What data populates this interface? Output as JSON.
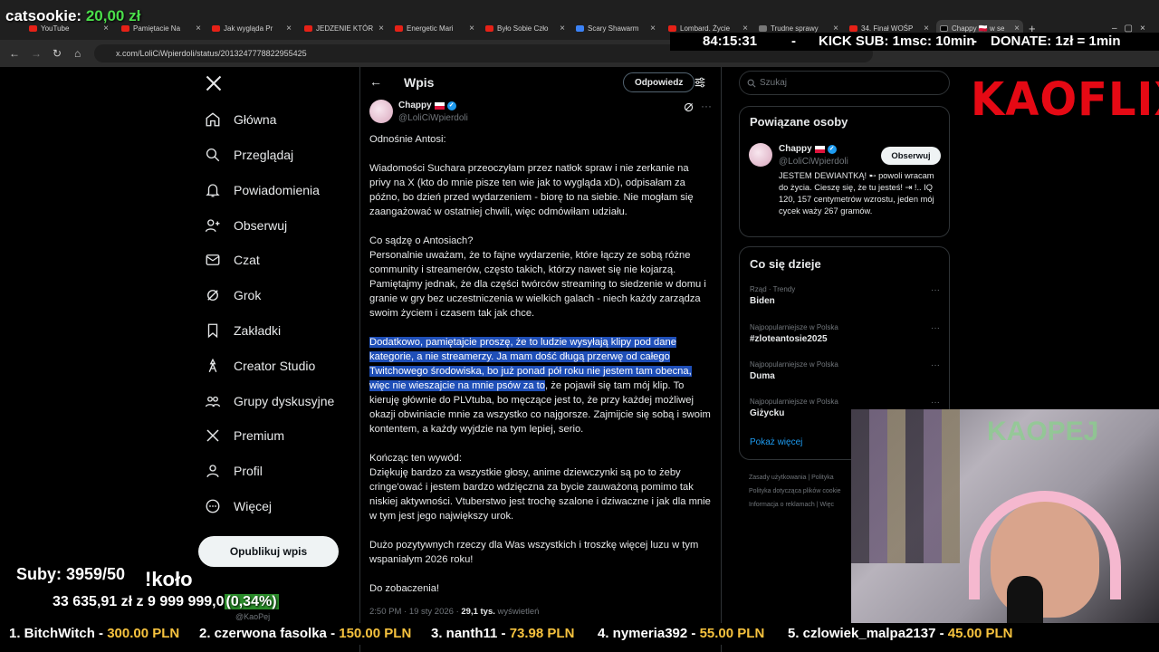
{
  "browser": {
    "tabs": [
      "YouTube",
      "Pamiętacie Na",
      "Jak wygląda Pr",
      "JEDZENIE KTÓR",
      "Energetic Mari",
      "Było Sobie Czło",
      "Scary Shawarm",
      "Lombard. Życie",
      "Trudne sprawy",
      "34. Finał WOŚP",
      "Chappy 🇵🇱 w se"
    ],
    "url": "x.com/LoliCiWpierdoli/status/2013247778822955425"
  },
  "overlay": {
    "catsookie_label": "catsookie:",
    "catsookie_amount": "20,00 zł",
    "timer": "84:15:31",
    "dash": "-",
    "kick_sub": "KICK SUB: 1msc: 10min",
    "dash2": "-",
    "donate": "DONATE: 1zł = 1min",
    "subs": "Suby: 3959/50",
    "kolo": "!koło",
    "money_current": "33 635,91 zł",
    "money_goal": "z 9 999 999,0",
    "money_pct": "(0,34%)",
    "kaoflix": "KAOFLIX",
    "webcam_sign": "KAOPEJ",
    "ticker": [
      {
        "rank": "1. BitchWitch - ",
        "amount": "300.00 PLN"
      },
      {
        "rank": "2. czerwona fasolka - ",
        "amount": "150.00 PLN"
      },
      {
        "rank": "3. nanth11 - ",
        "amount": "73.98 PLN"
      },
      {
        "rank": "4. nymeria392 - ",
        "amount": "55.00 PLN"
      },
      {
        "rank": "5. czlowiek_malpa2137 - ",
        "amount": "45.00 PLN"
      }
    ]
  },
  "nav": {
    "items": [
      {
        "label": "Główna",
        "icon": "home-icon"
      },
      {
        "label": "Przeglądaj",
        "icon": "search-icon"
      },
      {
        "label": "Powiadomienia",
        "icon": "bell-icon"
      },
      {
        "label": "Obserwuj",
        "icon": "follow-icon"
      },
      {
        "label": "Czat",
        "icon": "mail-icon"
      },
      {
        "label": "Grok",
        "icon": "grok-icon"
      },
      {
        "label": "Zakładki",
        "icon": "bookmark-icon"
      },
      {
        "label": "Creator Studio",
        "icon": "creator-icon"
      },
      {
        "label": "Grupy dyskusyjne",
        "icon": "groups-icon"
      },
      {
        "label": "Premium",
        "icon": "x-premium-icon"
      },
      {
        "label": "Profil",
        "icon": "profile-icon"
      },
      {
        "label": "Więcej",
        "icon": "more-circle-icon"
      }
    ],
    "post_button": "Opublikuj wpis",
    "bottom_handle": "@KaoPej"
  },
  "post": {
    "header_title": "Wpis",
    "reply_button": "Odpowiedz",
    "author_name": "Chappy",
    "author_handle": "@LoliCiWpierdoli",
    "p1": "Odnośnie Antosi:",
    "p2": "Wiadomości Suchara przeoczyłam przez natłok spraw i nie zerkanie na privy na X (kto do mnie pisze ten wie jak to wygląda xD), odpisałam za późno, bo dzień przed wydarzeniem - biorę to na siebie. Nie mogłam się zaangażować w ostatniej chwili, więc odmówiłam udziału.",
    "p3": "Co sądzę o Antosiach?\nPersonalnie uważam, że to fajne wydarzenie, które łączy ze sobą różne community i streamerów, często takich, którzy nawet się nie kojarzą. Pamiętajmy jednak, że dla części twórców streaming to siedzenie w domu i granie w gry bez uczestniczenia w wielkich galach - niech każdy zarządza swoim życiem i czasem tak jak chce.",
    "p4_highlight": "Dodatkowo, pamiętajcie proszę, że to ludzie wysyłają klipy pod dane kategorie, a nie streamerzy. Ja mam dość długą przerwę od całego Twitchowego środowiska, bo już ponad pół roku nie jestem tam obecna, więc nie wieszajcie na mnie psów za to",
    "p4_rest": ", że pojawił się tam mój klip. To kieruję głównie do PLVtuba, bo męczące jest to, że przy każdej możliwej okazji obwiniacie mnie za wszystko co najgorsze. Zajmijcie się sobą i swoim kontentem, a każdy wyjdzie na tym lepiej, serio.",
    "p5": "Kończąc ten wywód:\nDziękuję bardzo za wszystkie głosy, anime dziewczynki są po to żeby cringe'ować i jestem bardzo wdzięczna za bycie zauważoną pomimo tak niskiej aktywności. Vtuberstwo jest trochę szalone i dziwaczne i jak dla mnie w tym jest jego największy urok.",
    "p6": "Dużo pozytywnych rzeczy dla Was wszystkich i troszkę więcej luzu w tym wspaniałym 2026 roku!",
    "p7": "Do zobaczenia!",
    "time": "2:50 PM · 19 sty 2026 · ",
    "views": "29,1 tys.",
    "views_label": " wyświetleń"
  },
  "sidebar": {
    "search_placeholder": "Szukaj",
    "related_title": "Powiązane osoby",
    "related_name": "Chappy",
    "related_handle": "@LoliCiWpierdoli",
    "follow_button": "Obserwuj",
    "bio": "JESTEM DEWIANTKĄ! ➸ powoli wracam do życia. Cieszę się, że tu jesteś! ⇥ !.. IQ 120, 157 centymetrów wzrostu, jeden mój cycek waży 267 gramów.",
    "trends_title": "Co się dzieje",
    "trends": [
      {
        "cat": "Rząd · Trendy",
        "name": "Biden"
      },
      {
        "cat": "Najpopularniejsze w Polska",
        "name": "#zloteantosie2025"
      },
      {
        "cat": "Najpopularniejsze w Polska",
        "name": "Duma"
      },
      {
        "cat": "Najpopularniejsze w Polska",
        "name": "Giżycku"
      }
    ],
    "show_more": "Pokaż więcej",
    "footer": [
      "Zasady użytkowania  |  Polityka",
      "Polityka dotycząca plików cookie",
      "Informacja o reklamach  |  Więc"
    ]
  }
}
